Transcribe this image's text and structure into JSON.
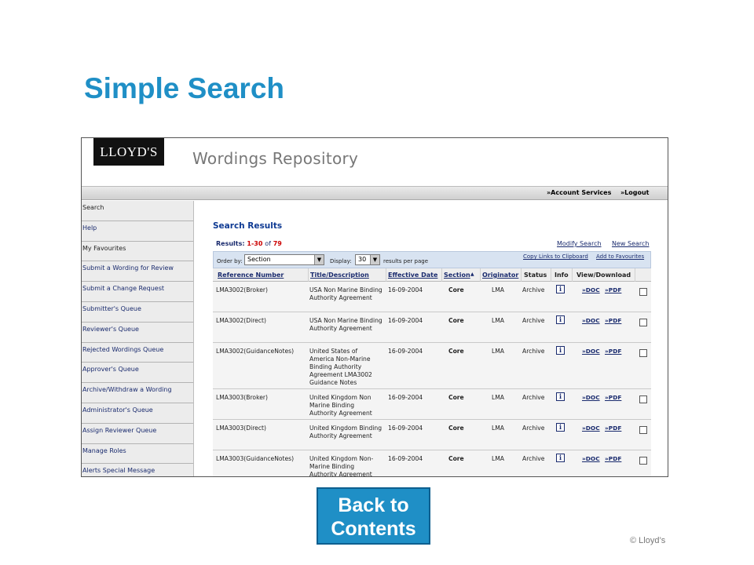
{
  "slide": {
    "title": "Simple Search",
    "back_button": "Back to Contents",
    "copyright": "© Lloyd’s"
  },
  "app": {
    "logo": "LLOYD'S",
    "title": "Wordings Repository",
    "topbar": {
      "account_services": "»Account Services",
      "logout": "»Logout"
    }
  },
  "sidebar": {
    "items": [
      "Search",
      "Help",
      "My Favourites",
      "Submit a Wording for Review",
      "Submit a Change Request",
      "Submitter's Queue",
      "Reviewer's Queue",
      "Rejected Wordings Queue",
      "Approver's Queue",
      "Archive/Withdraw a Wording",
      "Administrator's Queue",
      "Assign Reviewer Queue",
      "Manage Roles",
      "Alerts Special Message"
    ]
  },
  "search": {
    "title": "Search Results",
    "results_label": "Results:",
    "results_range": "1-30",
    "results_of": "of",
    "results_total": "79",
    "modify_search": "Modify Search",
    "new_search": "New Search",
    "order_by_label": "Order by:",
    "order_by_value": "Section",
    "display_label": "Display:",
    "display_value": "30",
    "per_page_label": "results per page",
    "copy_links": "Copy Links to Clipboard",
    "add_favourites": "Add to Favourites",
    "columns": [
      "Reference Number",
      "Title/Description",
      "Effective Date",
      "Section",
      "Originator",
      "Status",
      "Info",
      "View/Download"
    ],
    "rows": [
      {
        "ref": "LMA3002(Broker)",
        "title": "USA Non Marine Binding Authority Agreement",
        "date": "16-09-2004",
        "section": "Core",
        "originator": "LMA",
        "status": "Archive",
        "doc": "»DOC",
        "pdf": "»PDF"
      },
      {
        "ref": "LMA3002(Direct)",
        "title": "USA Non Marine Binding Authority Agreement",
        "date": "16-09-2004",
        "section": "Core",
        "originator": "LMA",
        "status": "Archive",
        "doc": "»DOC",
        "pdf": "»PDF"
      },
      {
        "ref": "LMA3002(GuidanceNotes)",
        "title": "United States of America Non-Marine Binding Authority Agreement LMA3002 Guidance Notes",
        "date": "16-09-2004",
        "section": "Core",
        "originator": "LMA",
        "status": "Archive",
        "doc": "»DOC",
        "pdf": "»PDF"
      },
      {
        "ref": "LMA3003(Broker)",
        "title": "United Kingdom Non Marine Binding Authority Agreement",
        "date": "16-09-2004",
        "section": "Core",
        "originator": "LMA",
        "status": "Archive",
        "doc": "»DOC",
        "pdf": "»PDF"
      },
      {
        "ref": "LMA3003(Direct)",
        "title": "United Kingdom Binding Authority Agreement",
        "date": "16-09-2004",
        "section": "Core",
        "originator": "LMA",
        "status": "Archive",
        "doc": "»DOC",
        "pdf": "»PDF"
      },
      {
        "ref": "LMA3003(GuidanceNotes)",
        "title": "United Kingdom Non-Marine Binding Authority Agreement",
        "date": "16-09-2004",
        "section": "Core",
        "originator": "LMA",
        "status": "Archive",
        "doc": "»DOC",
        "pdf": "»PDF"
      }
    ]
  }
}
